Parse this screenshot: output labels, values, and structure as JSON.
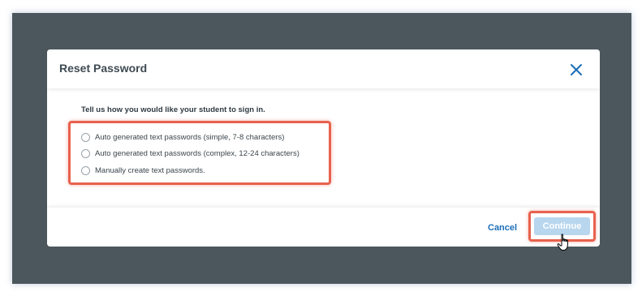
{
  "dialog": {
    "title": "Reset Password",
    "close_icon": "close-icon"
  },
  "body": {
    "prompt": "Tell us how you would like your student to sign in.",
    "options": [
      {
        "label": "Auto generated text passwords (simple, 7-8 characters)",
        "selected": false
      },
      {
        "label": "Auto generated text passwords (complex, 12-24 characters)",
        "selected": false
      },
      {
        "label": "Manually create text passwords.",
        "selected": false
      }
    ]
  },
  "footer": {
    "cancel_label": "Cancel",
    "continue_label": "Continue",
    "continue_disabled": true
  },
  "colors": {
    "overlay": "#4b575d",
    "accent": "#1c6fb8",
    "highlight": "#e8624e",
    "button_disabled": "#b8d6ee"
  }
}
